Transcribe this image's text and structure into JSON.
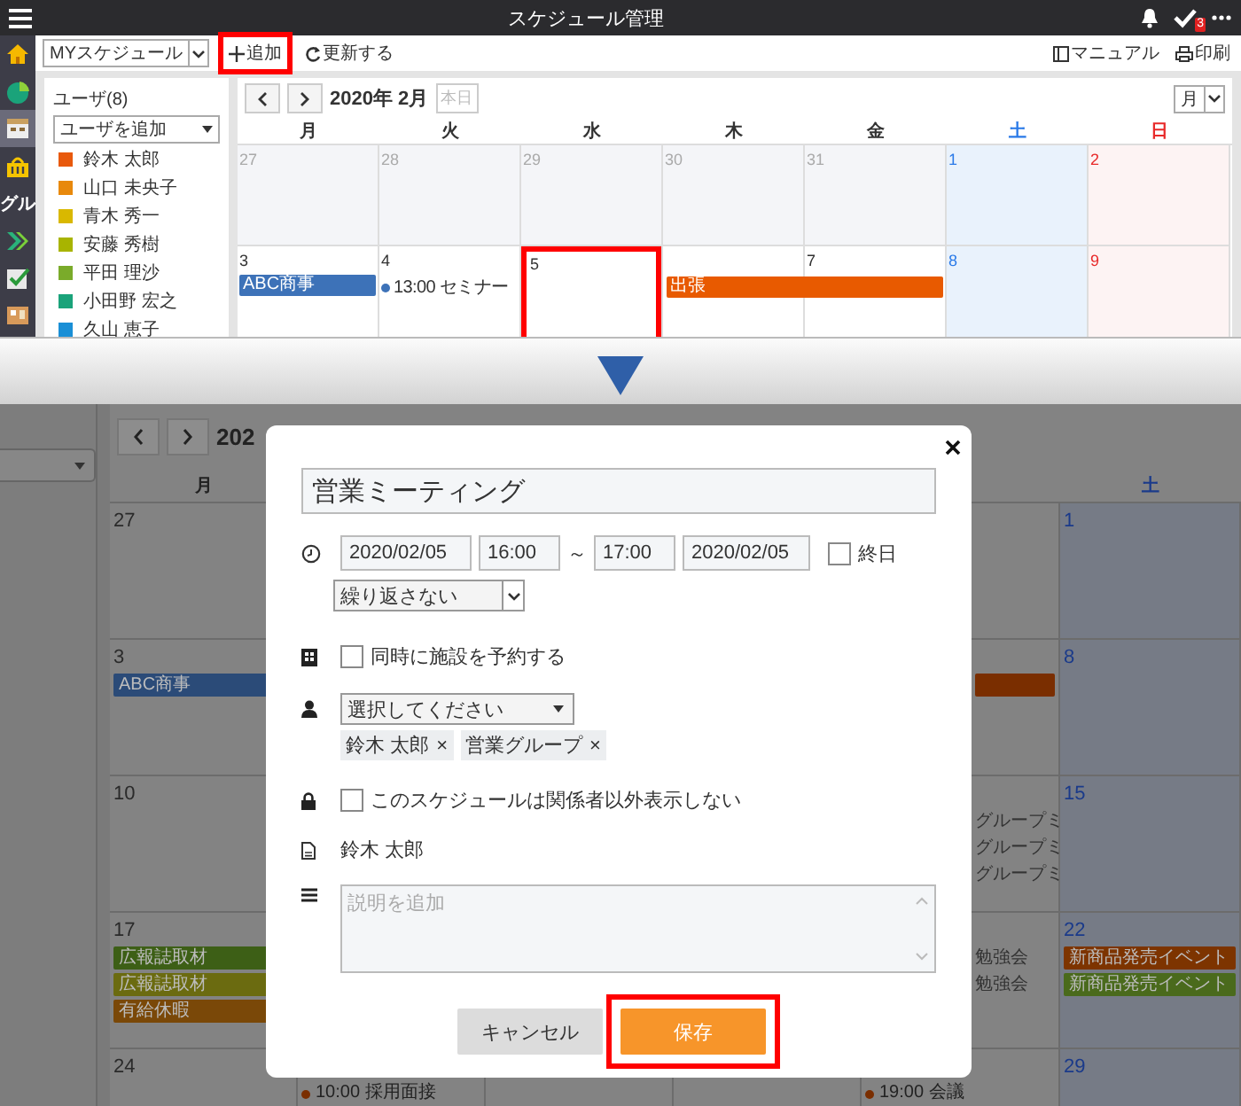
{
  "top_screen": {
    "header": {
      "title": "スケジュール管理",
      "badge": "3"
    },
    "rail": [
      {
        "kind": "home",
        "selected": false
      },
      {
        "kind": "chart",
        "selected": false
      },
      {
        "kind": "calendar",
        "selected": true
      },
      {
        "kind": "bag",
        "selected": false
      },
      {
        "kind": "text",
        "label": "グル",
        "selected": false
      },
      {
        "kind": "arrow",
        "selected": false
      },
      {
        "kind": "check",
        "selected": false
      },
      {
        "kind": "board",
        "selected": false
      }
    ],
    "toolbar": {
      "schedule_select": "MYスケジュール",
      "add_button": {
        "label": "追加",
        "highlighted": true
      },
      "refresh_button": "更新する",
      "manual_link": "マニュアル",
      "print_link": "印刷"
    },
    "users": {
      "title": "ユーザ(8)",
      "add_select": "ユーザを追加",
      "items": [
        {
          "name": "鈴木 太郎",
          "color": "#e8590c"
        },
        {
          "name": "山口 未央子",
          "color": "#e8890c"
        },
        {
          "name": "青木 秀一",
          "color": "#d9b800"
        },
        {
          "name": "安藤 秀樹",
          "color": "#a8b400"
        },
        {
          "name": "平田 理沙",
          "color": "#7aab2a"
        },
        {
          "name": "小田野 宏之",
          "color": "#1aa37a"
        },
        {
          "name": "久山 恵子",
          "color": "#1a8fd6"
        }
      ]
    },
    "calendar": {
      "month": "2020年 2月",
      "today_button": {
        "label": "本日",
        "disabled": true
      },
      "view_select": "月",
      "weekdays": [
        {
          "label": "月",
          "kind": "weekday"
        },
        {
          "label": "火",
          "kind": "weekday"
        },
        {
          "label": "水",
          "kind": "weekday"
        },
        {
          "label": "木",
          "kind": "weekday"
        },
        {
          "label": "金",
          "kind": "weekday"
        },
        {
          "label": "土",
          "kind": "saturday"
        },
        {
          "label": "日",
          "kind": "sunday"
        }
      ],
      "weeks": [
        {
          "days": [
            {
              "date": "27",
              "kind": "other"
            },
            {
              "date": "28",
              "kind": "other"
            },
            {
              "date": "29",
              "kind": "other"
            },
            {
              "date": "30",
              "kind": "other"
            },
            {
              "date": "31",
              "kind": "other"
            },
            {
              "date": "1",
              "kind": "saturday"
            },
            {
              "date": "2",
              "kind": "sunday"
            }
          ]
        },
        {
          "days": [
            {
              "date": "3",
              "kind": "weekday",
              "events": [
                {
                  "kind": "bar",
                  "label": "ABC商事",
                  "color": "#3d72b8"
                }
              ]
            },
            {
              "date": "4",
              "kind": "weekday",
              "events": [
                {
                  "kind": "dot",
                  "label": "13:00 セミナー",
                  "color": "#3d72b8"
                }
              ]
            },
            {
              "date": "5",
              "kind": "weekday",
              "highlighted": true
            },
            {
              "kind": "weekday",
              "events": [
                {
                  "kind": "bar",
                  "label": "出張",
                  "color": "#e85a00",
                  "continues": true
                }
              ]
            },
            {
              "date": "7",
              "kind": "weekday"
            },
            {
              "date": "8",
              "kind": "saturday"
            },
            {
              "date": "9",
              "kind": "sunday"
            }
          ]
        }
      ]
    }
  },
  "bottom_screen": {
    "nav_year": "202",
    "weekdays": [
      {
        "label": "月",
        "kind": "weekday"
      },
      {
        "label": "土",
        "kind": "saturday"
      }
    ],
    "weeks": [
      {
        "monday": {
          "date": "27"
        },
        "saturday": {
          "date": "1"
        }
      },
      {
        "monday": {
          "date": "3",
          "events": [
            {
              "kind": "bar",
              "label": "ABC商事",
              "color": "#2b4b78"
            }
          ]
        },
        "column_5": {
          "events": [
            {
              "kind": "bar",
              "color": "#7a2e00"
            }
          ]
        },
        "saturday": {
          "date": "8"
        }
      },
      {
        "monday": {
          "date": "10"
        },
        "column_5": {
          "events": [
            {
              "kind": "text",
              "label": "グループミ"
            },
            {
              "kind": "text",
              "label": "グループミ"
            },
            {
              "kind": "text",
              "label": "グループミ"
            }
          ]
        },
        "saturday": {
          "date": "15"
        }
      },
      {
        "monday": {
          "date": "17",
          "events": [
            {
              "kind": "bar",
              "label": "広報誌取材",
              "color": "#3d5f16"
            },
            {
              "kind": "bar",
              "label": "広報誌取材",
              "color": "#6b6b10"
            },
            {
              "kind": "bar",
              "label": "有給休暇",
              "color": "#7a4808"
            }
          ]
        },
        "column_5": {
          "events": [
            {
              "kind": "text",
              "label": "勉強会"
            },
            {
              "kind": "text",
              "label": "勉強会"
            }
          ]
        },
        "saturday": {
          "date": "22",
          "events": [
            {
              "kind": "bar",
              "label": "新商品発売イベント",
              "color": "#7d3400"
            },
            {
              "kind": "bar",
              "label": "新商品発売イベント",
              "color": "#4a6a1c"
            }
          ]
        }
      },
      {
        "monday": {
          "date": "24"
        },
        "column_2": {
          "events": [
            {
              "kind": "dot",
              "label": "10:00 採用面接",
              "color": "#7a2e00"
            }
          ]
        },
        "column_5": {
          "events": [
            {
              "kind": "dot",
              "label": "19:00 会議",
              "color": "#7a2e00"
            }
          ]
        },
        "saturday": {
          "date": "29"
        }
      }
    ],
    "dialog": {
      "title_value": "営業ミーティング",
      "start_date": "2020/02/05",
      "start_time": "16:00",
      "separator": "～",
      "end_time": "17:00",
      "end_date": "2020/02/05",
      "all_day": {
        "label": "終日",
        "checked": false
      },
      "repeat_select": "繰り返さない",
      "facility": {
        "label": "同時に施設を予約する",
        "checked": false
      },
      "participant_select": "選択してください",
      "participants": [
        {
          "label": "鈴木 太郎",
          "remove": "×"
        },
        {
          "label": "営業グループ",
          "remove": "×"
        }
      ],
      "private": {
        "label": "このスケジュールは関係者以外表示しない",
        "checked": false
      },
      "owner": "鈴木 太郎",
      "description_placeholder": "説明を追加",
      "cancel_button": "キャンセル",
      "save_button": {
        "label": "保存",
        "highlighted": true
      }
    }
  }
}
